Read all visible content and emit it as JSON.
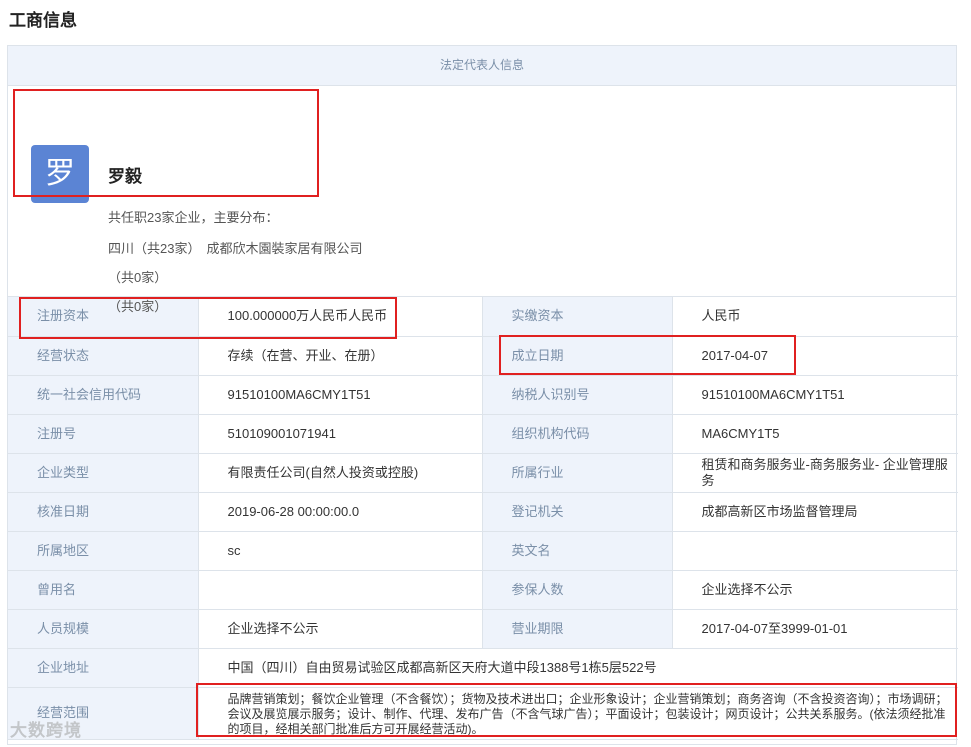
{
  "page": {
    "title": "工商信息"
  },
  "legal_rep": {
    "header": "法定代表人信息",
    "avatar_char": "罗",
    "name": "罗毅",
    "roles_summary": "共任职23家企业，主要分布：",
    "distribution": [
      {
        "region": "四川（共23家）",
        "company": "成都欣木園裝家居有限公司"
      },
      {
        "region": "（共0家）",
        "company": ""
      },
      {
        "region": "（共0家）",
        "company": ""
      }
    ]
  },
  "info": {
    "rows": [
      {
        "k1": "注册资本",
        "v1": "100.000000万人民币人民币",
        "k2": "实缴资本",
        "v2": "人民币"
      },
      {
        "k1": "经营状态",
        "v1": "存续（在营、开业、在册）",
        "k2": "成立日期",
        "v2": "2017-04-07"
      },
      {
        "k1": "统一社会信用代码",
        "v1": "91510100MA6CMY1T51",
        "k2": "纳税人识别号",
        "v2": "91510100MA6CMY1T51"
      },
      {
        "k1": "注册号",
        "v1": "510109001071941",
        "k2": "组织机构代码",
        "v2": "MA6CMY1T5"
      },
      {
        "k1": "企业类型",
        "v1": "有限责任公司(自然人投资或控股)",
        "k2": "所属行业",
        "v2": "租赁和商务服务业-商务服务业- 企业管理服务"
      },
      {
        "k1": "核准日期",
        "v1": "2019-06-28 00:00:00.0",
        "k2": "登记机关",
        "v2": "成都高新区市场监督管理局"
      },
      {
        "k1": "所属地区",
        "v1": "sc",
        "k2": "英文名",
        "v2": ""
      },
      {
        "k1": "曾用名",
        "v1": "",
        "k2": "参保人数",
        "v2": "企业选择不公示"
      },
      {
        "k1": "人员规模",
        "v1": "企业选择不公示",
        "k2": "营业期限",
        "v2": "2017-04-07至3999-01-01"
      }
    ],
    "address": {
      "k": "企业地址",
      "v": "中国（四川）自由贸易试验区成都高新区天府大道中段1388号1栋5层522号"
    },
    "scope": {
      "k": "经营范围",
      "v": "品牌营销策划；餐饮企业管理（不含餐饮）；货物及技术进出口；企业形象设计；企业营销策划；商务咨询（不含投资咨询）；市场调研；会议及展览展示服务；设计、制作、代理、发布广告（不含气球广告）；平面设计；包装设计；网页设计；公共关系服务。(依法须经批准的项目，经相关部门批准后方可开展经营活动)。"
    }
  },
  "watermark": "大数跨境",
  "colors": {
    "highlight": "#e02020",
    "header_bg": "#eef3fb",
    "avatar_bg": "#5b84d4",
    "key_text": "#7a8fa8"
  }
}
